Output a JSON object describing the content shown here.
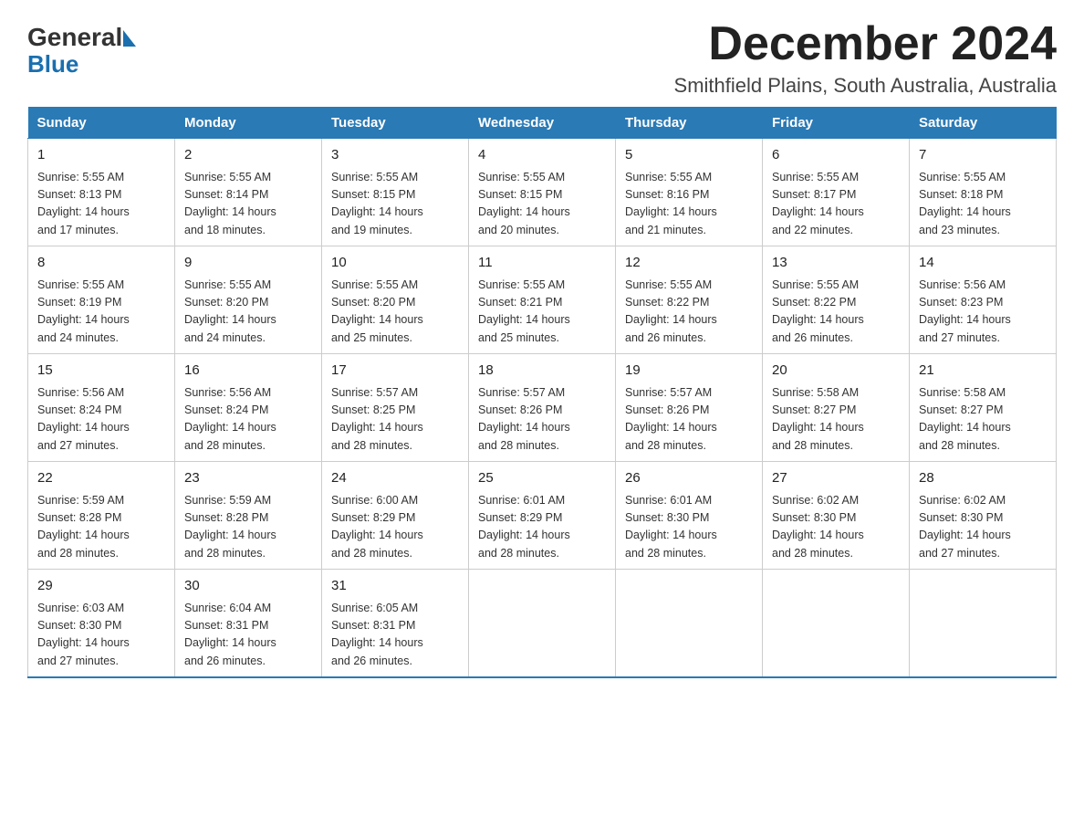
{
  "logo": {
    "general": "General",
    "blue": "Blue",
    "arrow": "▶"
  },
  "title": {
    "month": "December 2024",
    "location": "Smithfield Plains, South Australia, Australia"
  },
  "weekdays": [
    "Sunday",
    "Monday",
    "Tuesday",
    "Wednesday",
    "Thursday",
    "Friday",
    "Saturday"
  ],
  "weeks": [
    [
      {
        "day": "1",
        "sunrise": "5:55 AM",
        "sunset": "8:13 PM",
        "daylight": "14 hours and 17 minutes."
      },
      {
        "day": "2",
        "sunrise": "5:55 AM",
        "sunset": "8:14 PM",
        "daylight": "14 hours and 18 minutes."
      },
      {
        "day": "3",
        "sunrise": "5:55 AM",
        "sunset": "8:15 PM",
        "daylight": "14 hours and 19 minutes."
      },
      {
        "day": "4",
        "sunrise": "5:55 AM",
        "sunset": "8:15 PM",
        "daylight": "14 hours and 20 minutes."
      },
      {
        "day": "5",
        "sunrise": "5:55 AM",
        "sunset": "8:16 PM",
        "daylight": "14 hours and 21 minutes."
      },
      {
        "day": "6",
        "sunrise": "5:55 AM",
        "sunset": "8:17 PM",
        "daylight": "14 hours and 22 minutes."
      },
      {
        "day": "7",
        "sunrise": "5:55 AM",
        "sunset": "8:18 PM",
        "daylight": "14 hours and 23 minutes."
      }
    ],
    [
      {
        "day": "8",
        "sunrise": "5:55 AM",
        "sunset": "8:19 PM",
        "daylight": "14 hours and 24 minutes."
      },
      {
        "day": "9",
        "sunrise": "5:55 AM",
        "sunset": "8:20 PM",
        "daylight": "14 hours and 24 minutes."
      },
      {
        "day": "10",
        "sunrise": "5:55 AM",
        "sunset": "8:20 PM",
        "daylight": "14 hours and 25 minutes."
      },
      {
        "day": "11",
        "sunrise": "5:55 AM",
        "sunset": "8:21 PM",
        "daylight": "14 hours and 25 minutes."
      },
      {
        "day": "12",
        "sunrise": "5:55 AM",
        "sunset": "8:22 PM",
        "daylight": "14 hours and 26 minutes."
      },
      {
        "day": "13",
        "sunrise": "5:55 AM",
        "sunset": "8:22 PM",
        "daylight": "14 hours and 26 minutes."
      },
      {
        "day": "14",
        "sunrise": "5:56 AM",
        "sunset": "8:23 PM",
        "daylight": "14 hours and 27 minutes."
      }
    ],
    [
      {
        "day": "15",
        "sunrise": "5:56 AM",
        "sunset": "8:24 PM",
        "daylight": "14 hours and 27 minutes."
      },
      {
        "day": "16",
        "sunrise": "5:56 AM",
        "sunset": "8:24 PM",
        "daylight": "14 hours and 28 minutes."
      },
      {
        "day": "17",
        "sunrise": "5:57 AM",
        "sunset": "8:25 PM",
        "daylight": "14 hours and 28 minutes."
      },
      {
        "day": "18",
        "sunrise": "5:57 AM",
        "sunset": "8:26 PM",
        "daylight": "14 hours and 28 minutes."
      },
      {
        "day": "19",
        "sunrise": "5:57 AM",
        "sunset": "8:26 PM",
        "daylight": "14 hours and 28 minutes."
      },
      {
        "day": "20",
        "sunrise": "5:58 AM",
        "sunset": "8:27 PM",
        "daylight": "14 hours and 28 minutes."
      },
      {
        "day": "21",
        "sunrise": "5:58 AM",
        "sunset": "8:27 PM",
        "daylight": "14 hours and 28 minutes."
      }
    ],
    [
      {
        "day": "22",
        "sunrise": "5:59 AM",
        "sunset": "8:28 PM",
        "daylight": "14 hours and 28 minutes."
      },
      {
        "day": "23",
        "sunrise": "5:59 AM",
        "sunset": "8:28 PM",
        "daylight": "14 hours and 28 minutes."
      },
      {
        "day": "24",
        "sunrise": "6:00 AM",
        "sunset": "8:29 PM",
        "daylight": "14 hours and 28 minutes."
      },
      {
        "day": "25",
        "sunrise": "6:01 AM",
        "sunset": "8:29 PM",
        "daylight": "14 hours and 28 minutes."
      },
      {
        "day": "26",
        "sunrise": "6:01 AM",
        "sunset": "8:30 PM",
        "daylight": "14 hours and 28 minutes."
      },
      {
        "day": "27",
        "sunrise": "6:02 AM",
        "sunset": "8:30 PM",
        "daylight": "14 hours and 28 minutes."
      },
      {
        "day": "28",
        "sunrise": "6:02 AM",
        "sunset": "8:30 PM",
        "daylight": "14 hours and 27 minutes."
      }
    ],
    [
      {
        "day": "29",
        "sunrise": "6:03 AM",
        "sunset": "8:30 PM",
        "daylight": "14 hours and 27 minutes."
      },
      {
        "day": "30",
        "sunrise": "6:04 AM",
        "sunset": "8:31 PM",
        "daylight": "14 hours and 26 minutes."
      },
      {
        "day": "31",
        "sunrise": "6:05 AM",
        "sunset": "8:31 PM",
        "daylight": "14 hours and 26 minutes."
      },
      null,
      null,
      null,
      null
    ]
  ],
  "labels": {
    "sunrise": "Sunrise:",
    "sunset": "Sunset:",
    "daylight": "Daylight:"
  }
}
